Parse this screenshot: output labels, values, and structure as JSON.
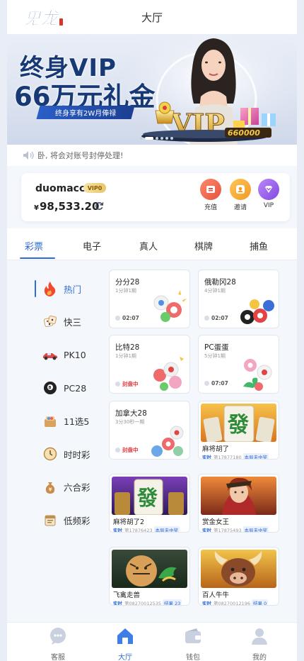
{
  "header": {
    "title": "大厅",
    "logo_text": "鬼龙"
  },
  "banner": {
    "headline_1": "终身VIP",
    "headline_2": "66万元礼金",
    "ribbon": "终身享有2W月俸禄",
    "badge_text": "VIP",
    "amount_text": "660000",
    "slide_count": 6,
    "active_slide": 1
  },
  "notice": {
    "text": "卧, 将会对账号封停处理!"
  },
  "user": {
    "name": "duomacc",
    "vip_badge": "VIP0",
    "currency": "¥",
    "balance": "98,533.20"
  },
  "quick_actions": [
    {
      "label": "充值",
      "icon": "deposit-icon",
      "color": "#f06a4f"
    },
    {
      "label": "邀请",
      "icon": "invite-icon",
      "color": "#f3a532"
    },
    {
      "label": "VIP",
      "icon": "vip-diamond-icon",
      "color": "#9b5ce8"
    }
  ],
  "tabs": [
    "彩票",
    "电子",
    "真人",
    "棋牌",
    "捕鱼"
  ],
  "active_tab": "彩票",
  "sidebar": [
    {
      "label": "热门",
      "icon": "fire-icon"
    },
    {
      "label": "快三",
      "icon": "dice-icon"
    },
    {
      "label": "PK10",
      "icon": "race-car-icon"
    },
    {
      "label": "PC28",
      "icon": "eight-ball-icon"
    },
    {
      "label": "11选5",
      "icon": "lottery-box-icon"
    },
    {
      "label": "时时彩",
      "icon": "clock-icon"
    },
    {
      "label": "六合彩",
      "icon": "money-bag-icon"
    },
    {
      "label": "低频彩",
      "icon": "calendar-icon"
    }
  ],
  "lottery_cards": [
    {
      "title": "分分28",
      "sub": "1分钟1期",
      "status": "02:07",
      "closed": false
    },
    {
      "title": "俄勒冈28",
      "sub": "4分钟1期",
      "status": "02:07",
      "closed": false
    },
    {
      "title": "比特28",
      "sub": "1分钟1期",
      "status": "封盘中",
      "closed": true
    },
    {
      "title": "PC蛋蛋",
      "sub": "5分钟1期",
      "status": "07:07",
      "closed": false
    },
    {
      "title": "加拿大28",
      "sub": "3分30秒一期",
      "status": "封盘中",
      "closed": true
    }
  ],
  "game_cards": [
    {
      "name": "麻将胡了",
      "tag": "实时",
      "issue": "第17877180",
      "result": "本局未中奖"
    },
    {
      "name": "麻将胡了2",
      "tag": "实时",
      "issue": "第17876423",
      "result": "本局未中奖"
    },
    {
      "name": "赏金女王",
      "tag": "实时",
      "issue": "第17875493",
      "result": "本局未中奖"
    },
    {
      "name": "飞禽走兽",
      "tag": "实时",
      "issue": "第08270012535",
      "result": "结果 23"
    },
    {
      "name": "百人牛牛",
      "tag": "实时",
      "issue": "第08270012196",
      "result": "结果 0"
    }
  ],
  "bottom_nav": [
    {
      "label": "客服",
      "icon": "support-icon"
    },
    {
      "label": "大厅",
      "icon": "home-icon"
    },
    {
      "label": "钱包",
      "icon": "wallet-icon"
    },
    {
      "label": "我的",
      "icon": "profile-icon"
    }
  ],
  "active_nav": "大厅",
  "colors": {
    "accent": "#2e6bd6",
    "closed": "#e0393e",
    "background": "#f4f7fc"
  }
}
